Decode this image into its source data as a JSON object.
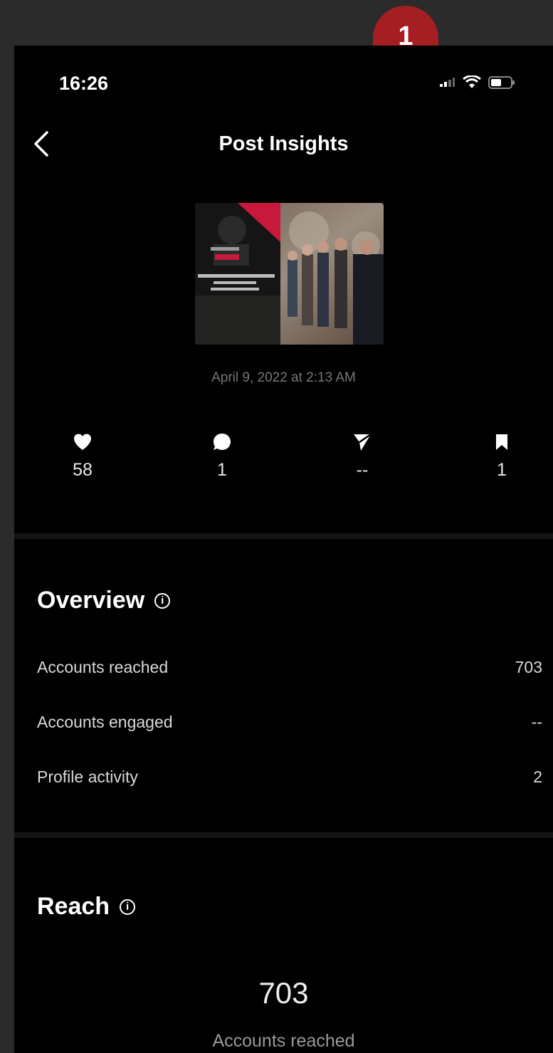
{
  "badge": {
    "number": "1"
  },
  "status_bar": {
    "time": "16:26"
  },
  "header": {
    "title": "Post Insights"
  },
  "post": {
    "date": "April 9, 2022 at 2:13 AM"
  },
  "stats": {
    "likes": "58",
    "comments": "1",
    "shares": "--",
    "saves": "1"
  },
  "overview": {
    "title": "Overview",
    "rows": [
      {
        "label": "Accounts reached",
        "value": "703"
      },
      {
        "label": "Accounts engaged",
        "value": "--"
      },
      {
        "label": "Profile activity",
        "value": "2"
      }
    ]
  },
  "reach": {
    "title": "Reach",
    "value": "703",
    "label": "Accounts reached"
  },
  "colors": {
    "badge": "#a51f22",
    "background": "#000000",
    "frame": "#2b2b2b"
  },
  "icons": [
    "back-chevron-icon",
    "heart-icon",
    "comment-icon",
    "share-icon",
    "bookmark-icon",
    "info-icon",
    "signal-icon",
    "wifi-icon",
    "battery-icon"
  ]
}
